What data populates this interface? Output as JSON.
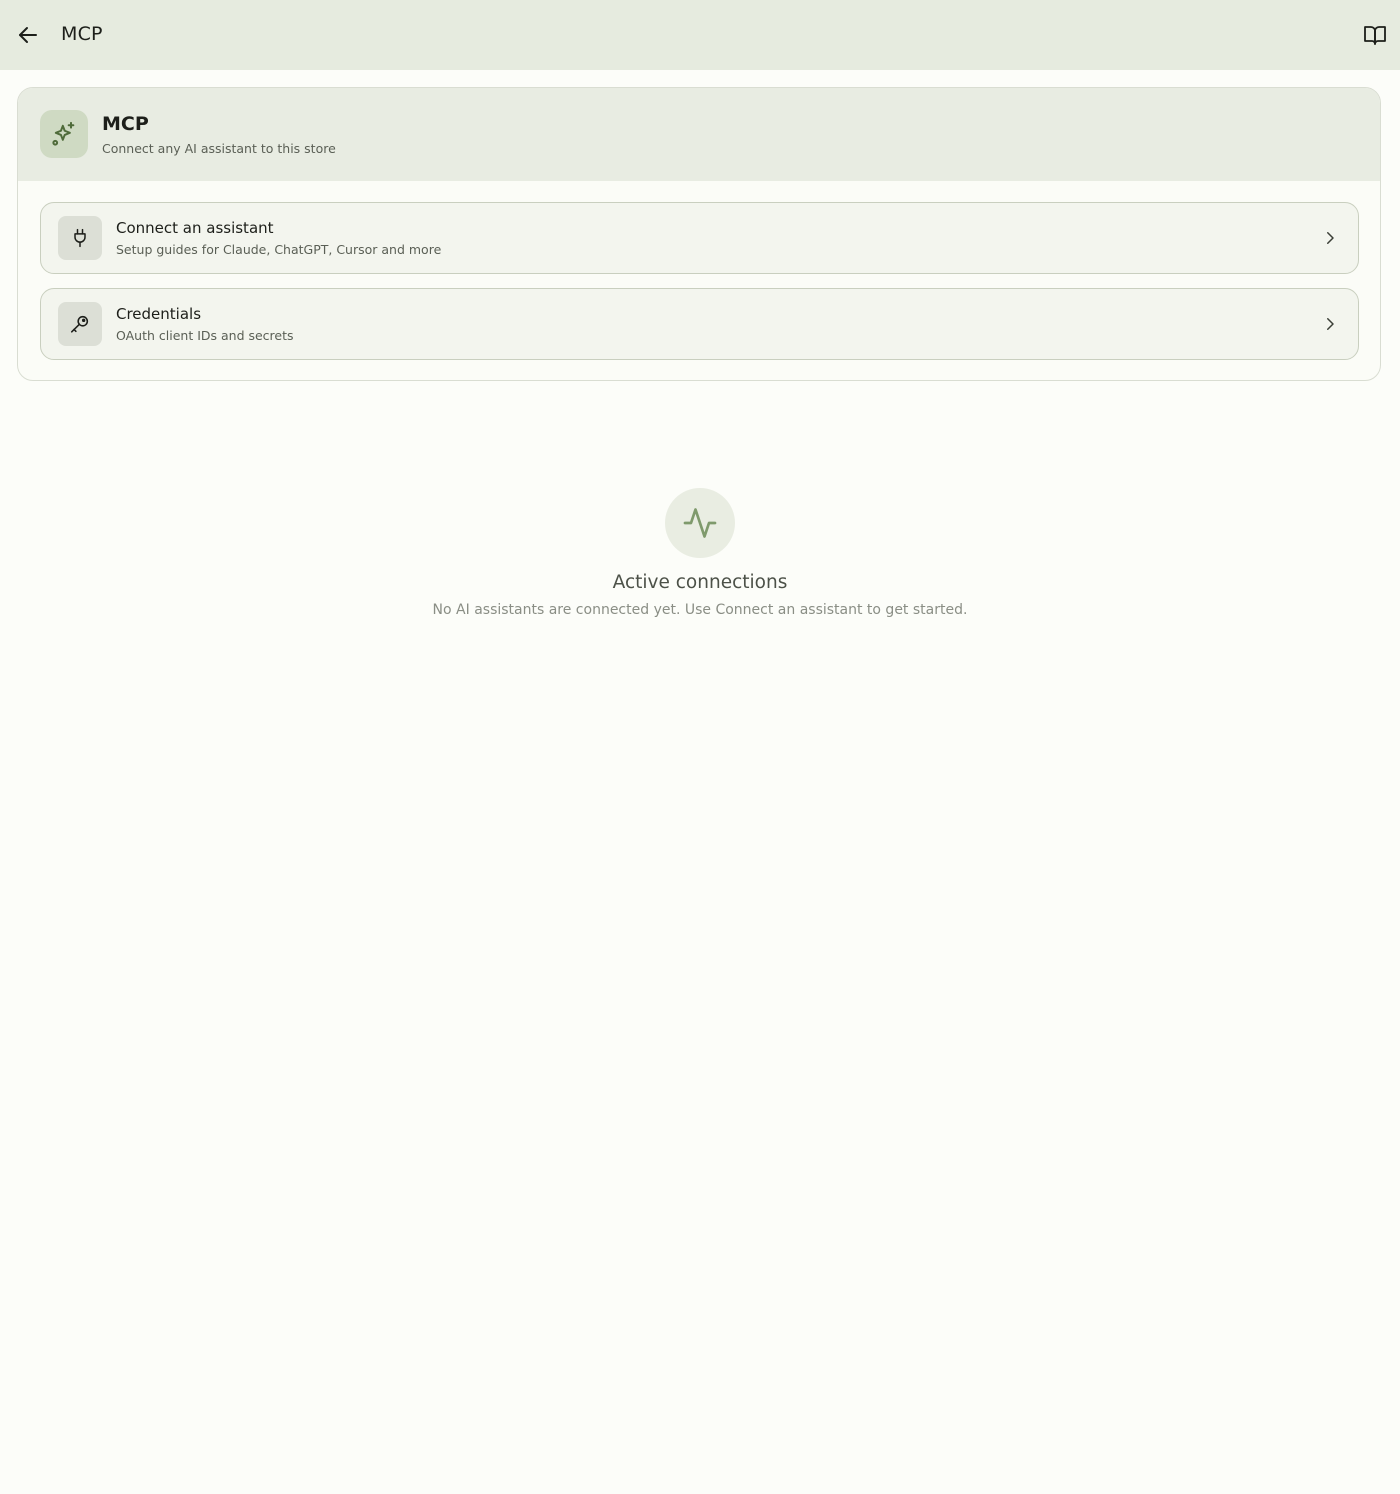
{
  "topbar": {
    "back_icon": "arrow-left-icon",
    "title": "MCP",
    "docs_icon": "book-open-icon"
  },
  "header": {
    "icon": "sparkles-icon",
    "title": "MCP",
    "subtitle": "Connect any AI assistant to this store"
  },
  "items": [
    {
      "icon": "plug-icon",
      "title": "Connect an assistant",
      "subtitle": "Setup guides for Claude, ChatGPT, Cursor and more",
      "chevron_icon": "chevron-right-icon"
    },
    {
      "icon": "key-icon",
      "title": "Credentials",
      "subtitle": "OAuth client IDs and secrets",
      "chevron_icon": "chevron-right-icon"
    }
  ],
  "empty_state": {
    "icon": "activity-icon",
    "title": "Active connections",
    "text": "No AI assistants are connected yet. Use Connect an assistant to get started."
  },
  "colors": {
    "page_background": "#fcfdf9",
    "topbar_background": "#e6ebdf",
    "accent_green": "#4f6b3a",
    "muted_green": "#7f9a6c"
  }
}
